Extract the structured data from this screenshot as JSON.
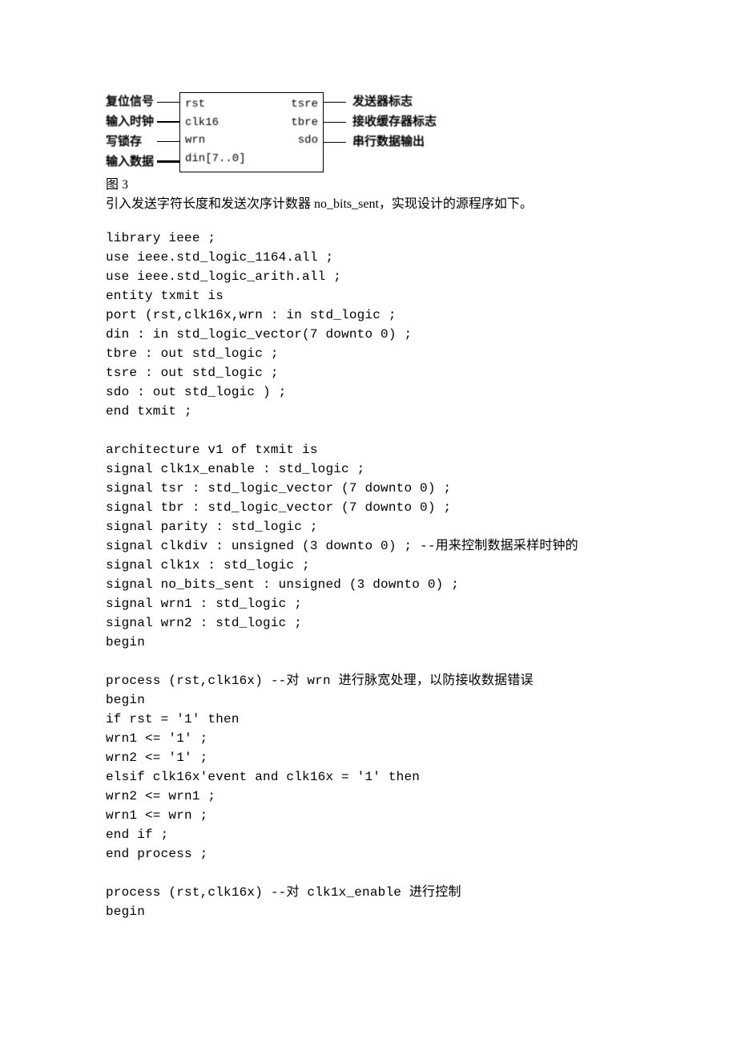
{
  "diagram": {
    "left_labels": [
      "复位信号",
      "输入时钟",
      "写锁存",
      "输入数据"
    ],
    "block_left": [
      "rst",
      "clk16",
      "wrn",
      "din[7..0]"
    ],
    "block_right": [
      "tsre",
      "tbre",
      "sdo"
    ],
    "right_labels": [
      "发送器标志",
      "接收缓存器标志",
      "串行数据输出"
    ]
  },
  "caption": "图 3",
  "intro": "引入发送字符长度和发送次序计数器 no_bits_sent，实现设计的源程序如下。",
  "code_lines": [
    "library ieee ;",
    "use ieee.std_logic_1164.all ;",
    "use ieee.std_logic_arith.all ;",
    "entity txmit is",
    "port (rst,clk16x,wrn : in std_logic ;",
    "din : in std_logic_vector(7 downto 0) ;",
    "tbre : out std_logic ;",
    "tsre : out std_logic ;",
    "sdo : out std_logic ) ;",
    "end txmit ;",
    "",
    "architecture v1 of txmit is",
    "signal clk1x_enable : std_logic ;",
    "signal tsr : std_logic_vector (7 downto 0) ;",
    "signal tbr : std_logic_vector (7 downto 0) ;",
    "signal parity : std_logic ;",
    "signal clkdiv : unsigned (3 downto 0) ; --用来控制数据采样时钟的",
    "signal clk1x : std_logic ;",
    "signal no_bits_sent : unsigned (3 downto 0) ;",
    "signal wrn1 : std_logic ;",
    "signal wrn2 : std_logic ;",
    "begin",
    "",
    "process (rst,clk16x) --对 wrn 进行脉宽处理，以防接收数据错误",
    "begin",
    "if rst = '1' then",
    "wrn1 <= '1' ;",
    "wrn2 <= '1' ;",
    "elsif clk16x'event and clk16x = '1' then",
    "wrn2 <= wrn1 ;",
    "wrn1 <= wrn ;",
    "end if ;",
    "end process ;",
    "",
    "process (rst,clk16x) --对 clk1x_enable 进行控制",
    "begin"
  ]
}
